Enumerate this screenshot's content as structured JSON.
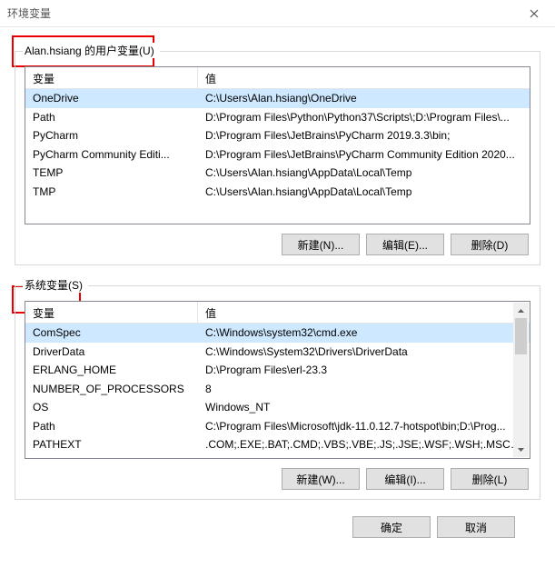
{
  "window": {
    "title": "环境变量"
  },
  "user_section": {
    "legend": "Alan.hsiang 的用户变量(U)",
    "columns": {
      "var": "变量",
      "val": "值"
    },
    "rows": [
      {
        "var": "OneDrive",
        "val": "C:\\Users\\Alan.hsiang\\OneDrive",
        "selected": true
      },
      {
        "var": "Path",
        "val": "D:\\Program Files\\Python\\Python37\\Scripts\\;D:\\Program Files\\..."
      },
      {
        "var": "PyCharm",
        "val": "D:\\Program Files\\JetBrains\\PyCharm 2019.3.3\\bin;"
      },
      {
        "var": "PyCharm Community Editi...",
        "val": "D:\\Program Files\\JetBrains\\PyCharm Community Edition 2020..."
      },
      {
        "var": "TEMP",
        "val": "C:\\Users\\Alan.hsiang\\AppData\\Local\\Temp"
      },
      {
        "var": "TMP",
        "val": "C:\\Users\\Alan.hsiang\\AppData\\Local\\Temp"
      }
    ],
    "buttons": {
      "new": "新建(N)...",
      "edit": "编辑(E)...",
      "delete": "删除(D)"
    }
  },
  "system_section": {
    "legend": "系统变量(S)",
    "columns": {
      "var": "变量",
      "val": "值"
    },
    "rows": [
      {
        "var": "ComSpec",
        "val": "C:\\Windows\\system32\\cmd.exe",
        "selected": true
      },
      {
        "var": "DriverData",
        "val": "C:\\Windows\\System32\\Drivers\\DriverData"
      },
      {
        "var": "ERLANG_HOME",
        "val": "D:\\Program Files\\erl-23.3"
      },
      {
        "var": "NUMBER_OF_PROCESSORS",
        "val": "8"
      },
      {
        "var": "OS",
        "val": "Windows_NT"
      },
      {
        "var": "Path",
        "val": "C:\\Program Files\\Microsoft\\jdk-11.0.12.7-hotspot\\bin;D:\\Prog..."
      },
      {
        "var": "PATHEXT",
        "val": ".COM;.EXE;.BAT;.CMD;.VBS;.VBE;.JS;.JSE;.WSF;.WSH;.MSC;.PY;.P..."
      }
    ],
    "buttons": {
      "new": "新建(W)...",
      "edit": "编辑(I)...",
      "delete": "删除(L)"
    }
  },
  "footer": {
    "ok": "确定",
    "cancel": "取消"
  }
}
